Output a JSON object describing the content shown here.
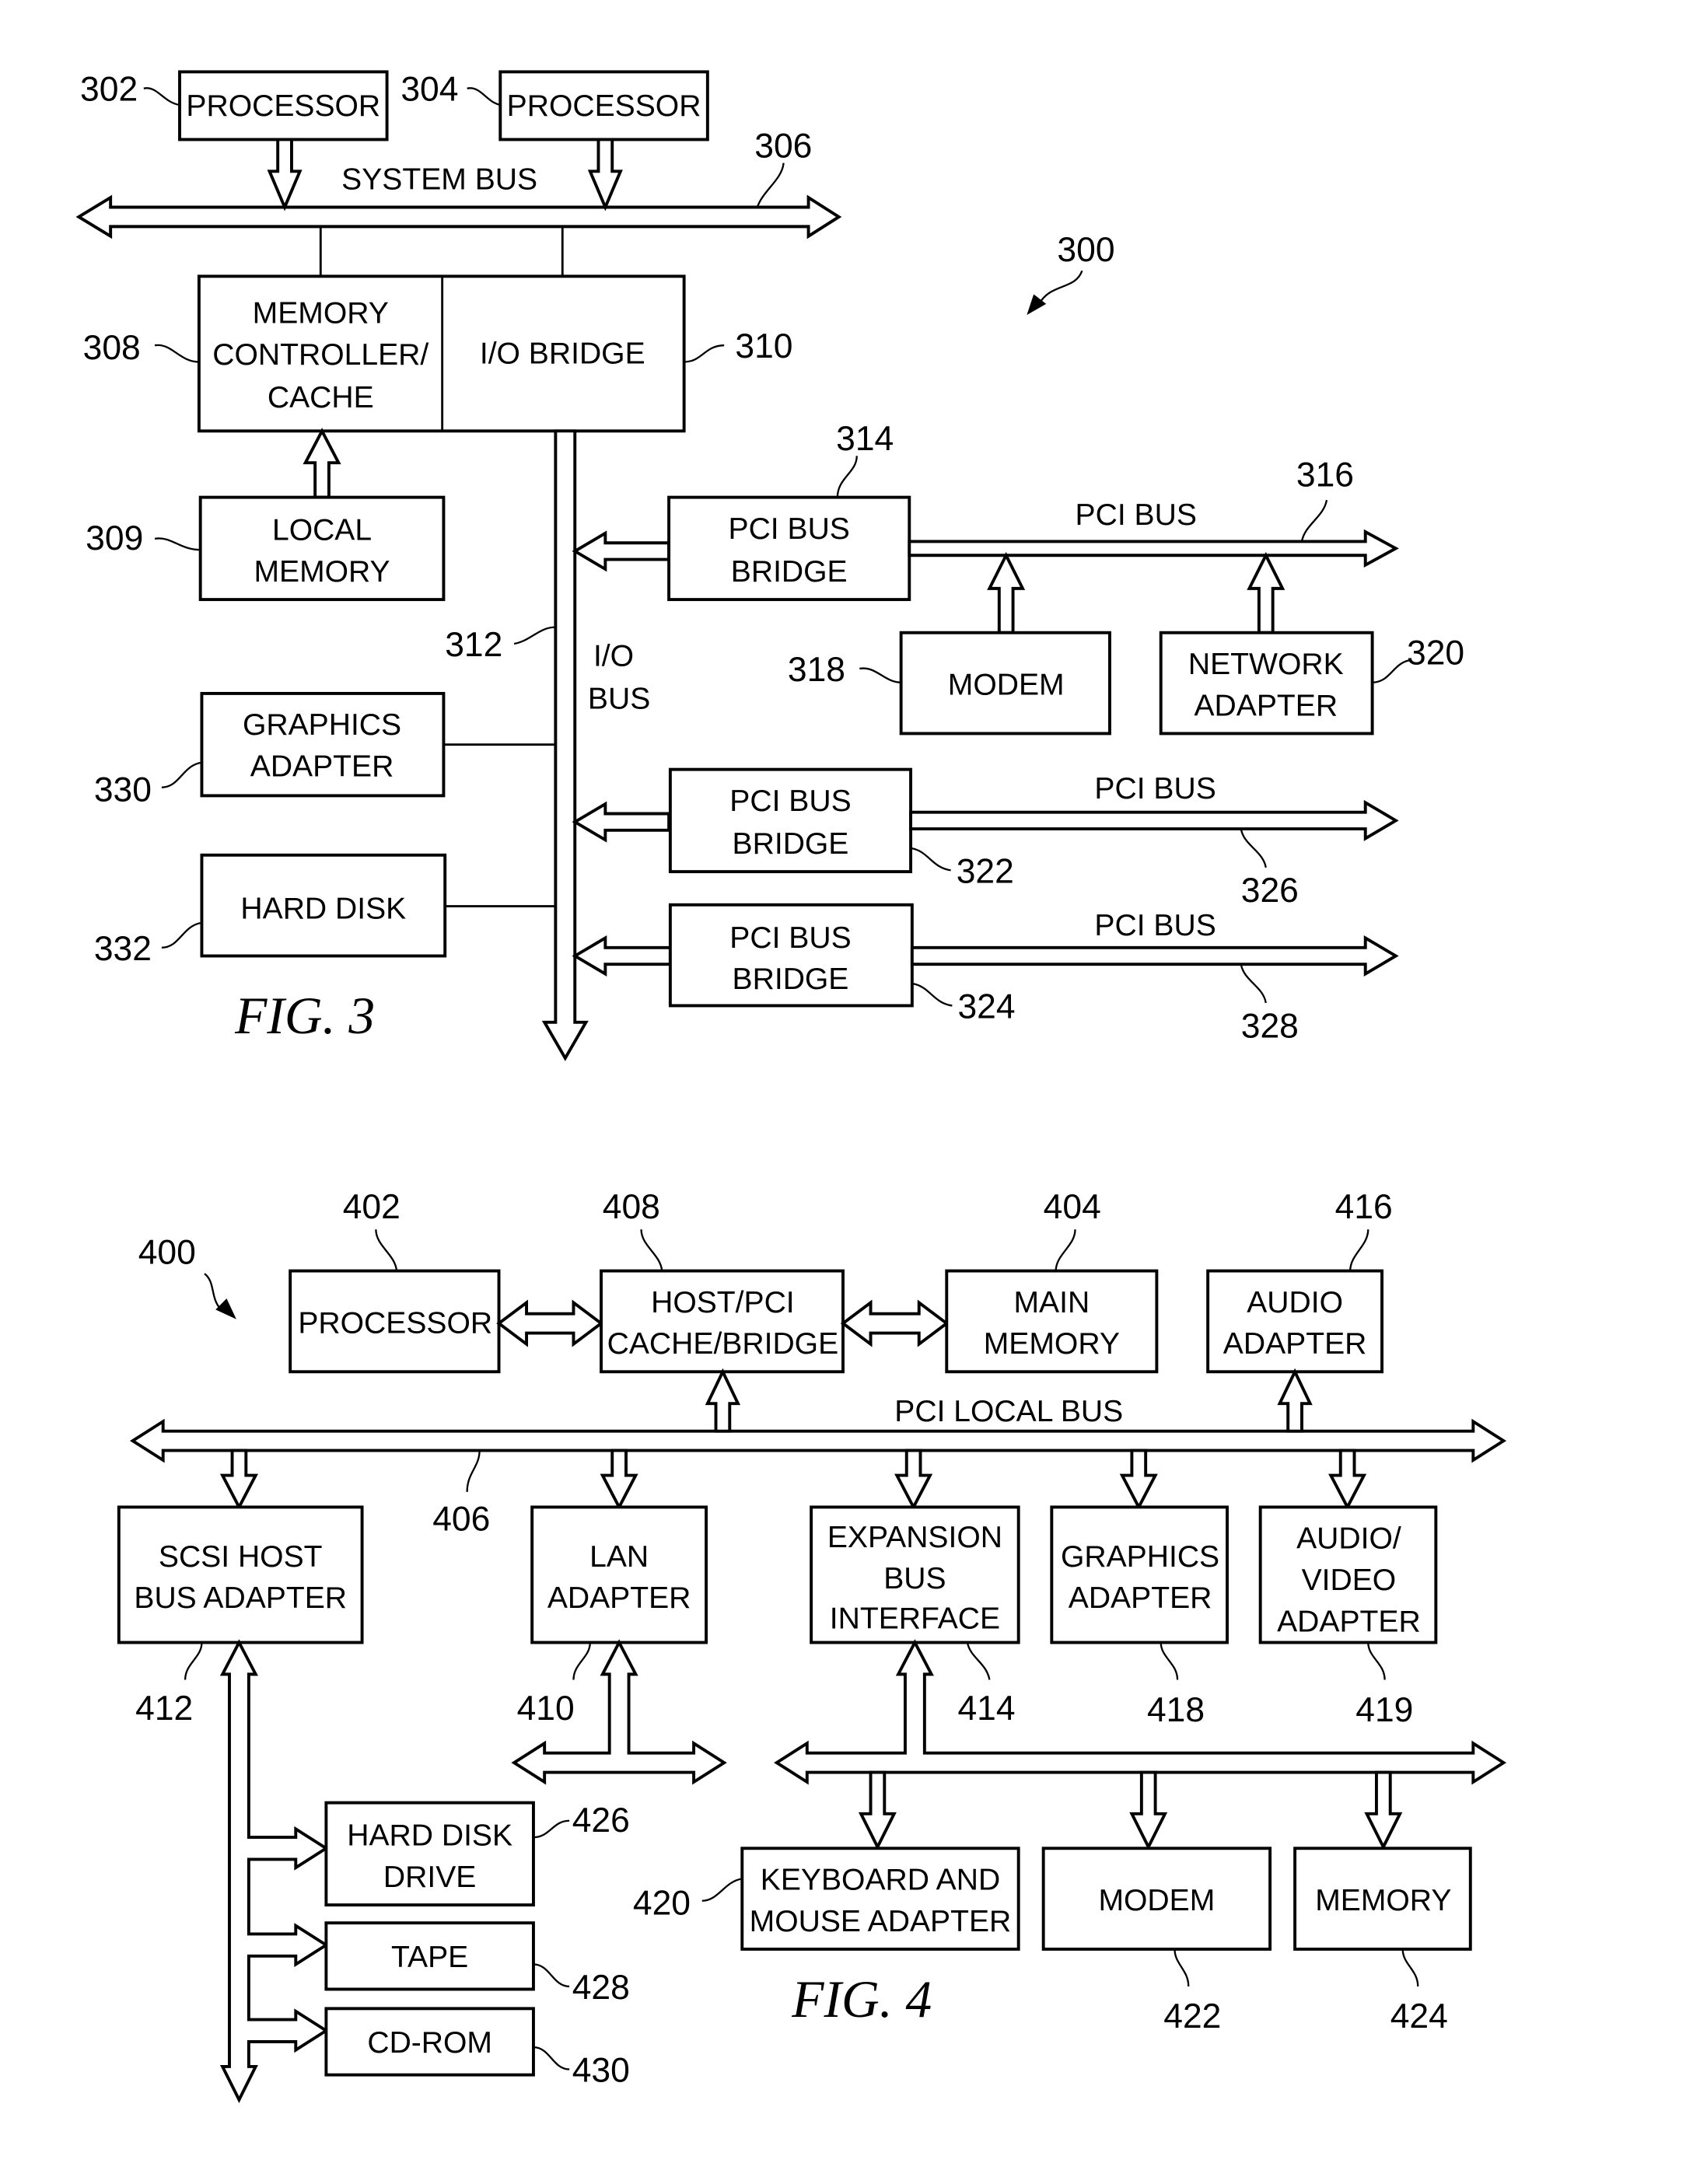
{
  "fig3": {
    "caption": "FIG. 3",
    "system_ref": "300",
    "blocks": {
      "proc1": {
        "lines": [
          "PROCESSOR"
        ],
        "ref": "302"
      },
      "proc2": {
        "lines": [
          "PROCESSOR"
        ],
        "ref": "304"
      },
      "memctl": {
        "lines": [
          "MEMORY",
          "CONTROLLER/",
          "CACHE"
        ],
        "ref": "308"
      },
      "iobridge": {
        "lines": [
          "I/O BRIDGE"
        ],
        "ref": "310"
      },
      "localmem": {
        "lines": [
          "LOCAL",
          "MEMORY"
        ],
        "ref": "309"
      },
      "pcibridge1": {
        "lines": [
          "PCI BUS",
          "BRIDGE"
        ],
        "ref": "314"
      },
      "modem": {
        "lines": [
          "MODEM"
        ],
        "ref": "318"
      },
      "netadapter": {
        "lines": [
          "NETWORK",
          "ADAPTER"
        ],
        "ref": "320"
      },
      "pcibridge2": {
        "lines": [
          "PCI BUS",
          "BRIDGE"
        ],
        "ref": "322"
      },
      "pcibridge3": {
        "lines": [
          "PCI BUS",
          "BRIDGE"
        ],
        "ref": "324"
      },
      "graphics": {
        "lines": [
          "GRAPHICS",
          "ADAPTER"
        ],
        "ref": "330"
      },
      "harddisk": {
        "lines": [
          "HARD DISK"
        ],
        "ref": "332"
      }
    },
    "buses": {
      "system": {
        "label": "SYSTEM BUS",
        "ref": "306"
      },
      "io": {
        "label_lines": [
          "I/O",
          "BUS"
        ],
        "ref": "312"
      },
      "pci1": {
        "label": "PCI BUS",
        "ref": "316"
      },
      "pci2": {
        "label": "PCI BUS",
        "ref": "326"
      },
      "pci3": {
        "label": "PCI BUS",
        "ref": "328"
      }
    }
  },
  "fig4": {
    "caption": "FIG. 4",
    "system_ref": "400",
    "blocks": {
      "processor": {
        "lines": [
          "PROCESSOR"
        ],
        "ref": "402"
      },
      "hostbridge": {
        "lines": [
          "HOST/PCI",
          "CACHE/BRIDGE"
        ],
        "ref": "408"
      },
      "mainmem": {
        "lines": [
          "MAIN",
          "MEMORY"
        ],
        "ref": "404"
      },
      "audio": {
        "lines": [
          "AUDIO",
          "ADAPTER"
        ],
        "ref": "416"
      },
      "scsi": {
        "lines": [
          "SCSI HOST",
          "BUS ADAPTER"
        ],
        "ref": "412"
      },
      "lan": {
        "lines": [
          "LAN",
          "ADAPTER"
        ],
        "ref": "410"
      },
      "expansion": {
        "lines": [
          "EXPANSION",
          "BUS",
          "INTERFACE"
        ],
        "ref": "414"
      },
      "graphics": {
        "lines": [
          "GRAPHICS",
          "ADAPTER"
        ],
        "ref": "418"
      },
      "av": {
        "lines": [
          "AUDIO/",
          "VIDEO",
          "ADAPTER"
        ],
        "ref": "419"
      },
      "hdd": {
        "lines": [
          "HARD DISK",
          "DRIVE"
        ],
        "ref": "426"
      },
      "tape": {
        "lines": [
          "TAPE"
        ],
        "ref": "428"
      },
      "cdrom": {
        "lines": [
          "CD-ROM"
        ],
        "ref": "430"
      },
      "kbd": {
        "lines": [
          "KEYBOARD AND",
          "MOUSE ADAPTER"
        ],
        "ref": "420"
      },
      "modem": {
        "lines": [
          "MODEM"
        ],
        "ref": "422"
      },
      "memory": {
        "lines": [
          "MEMORY"
        ],
        "ref": "424"
      }
    },
    "buses": {
      "pcilocal": {
        "label": "PCI LOCAL BUS",
        "ref": "406"
      }
    }
  }
}
